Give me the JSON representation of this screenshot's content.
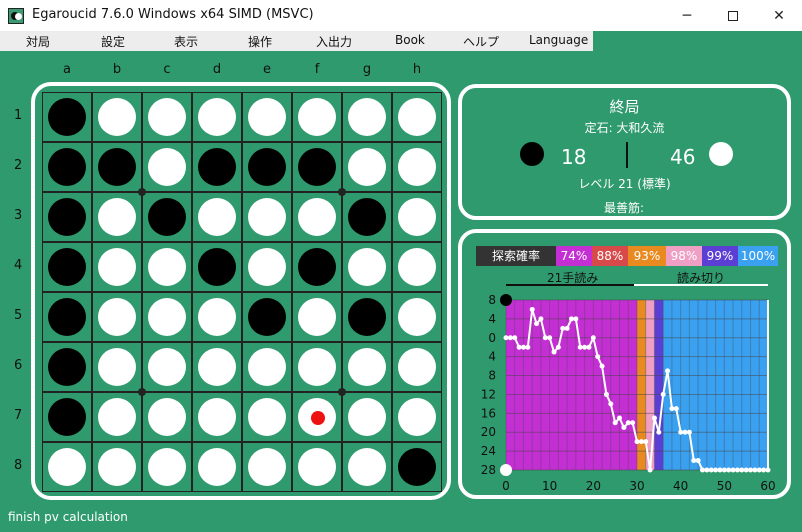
{
  "window": {
    "title": "Egaroucid 7.6.0 Windows x64 SIMD (MSVC)",
    "minimize": "─",
    "close": "✕"
  },
  "menu": [
    "対局",
    "設定",
    "表示",
    "操作",
    "入出力",
    "Book",
    "ヘルプ",
    "Language"
  ],
  "board": {
    "columns": [
      "a",
      "b",
      "c",
      "d",
      "e",
      "f",
      "g",
      "h"
    ],
    "rows": [
      "1",
      "2",
      "3",
      "4",
      "5",
      "6",
      "7",
      "8"
    ],
    "cells": [
      "BWWWWWWW",
      "BBWBBBWW",
      "BWBWWWBW",
      "BWWBWBWW",
      "BWWWBWBW",
      "BWWWWWWW",
      "BWWWWWWW",
      "WWWWWWWB"
    ],
    "hint": {
      "row": 6,
      "col": 5
    },
    "colors": {
      "black": "#000000",
      "white": "#ffffff",
      "hint": "#ee1111"
    }
  },
  "info": {
    "phase": "終局",
    "opening": "定石: 大和久流",
    "black_score": "18",
    "white_score": "46",
    "level": "レベル 21 (標準)",
    "best_line": "最善筋:"
  },
  "graph_legend": {
    "title": "探索確率",
    "items": [
      {
        "label": "74%",
        "color": "#c42fd4"
      },
      {
        "label": "88%",
        "color": "#d84a4a"
      },
      {
        "label": "93%",
        "color": "#e88a20"
      },
      {
        "label": "98%",
        "color": "#ef9fc4"
      },
      {
        "label": "99%",
        "color": "#5b3fd4"
      },
      {
        "label": "100%",
        "color": "#3aa0f0"
      }
    ],
    "depth_labels": [
      "21手読み",
      "読み切り"
    ]
  },
  "chart_data": {
    "type": "line",
    "x": [
      0,
      1,
      2,
      3,
      4,
      5,
      6,
      7,
      8,
      9,
      10,
      11,
      12,
      13,
      14,
      15,
      16,
      17,
      18,
      19,
      20,
      21,
      22,
      23,
      24,
      25,
      26,
      27,
      28,
      29,
      30,
      31,
      32,
      33,
      34,
      35,
      36,
      37,
      38,
      39,
      40,
      41,
      42,
      43,
      44,
      45,
      46,
      47,
      48,
      49,
      50,
      51,
      52,
      53,
      54,
      55,
      56,
      57,
      58,
      59,
      60
    ],
    "y": [
      0,
      0,
      0,
      -2,
      -2,
      -2,
      6,
      3,
      4,
      0,
      0,
      -3,
      -2,
      2,
      2,
      4,
      4,
      -2,
      -2,
      -2,
      0,
      -4,
      -6,
      -12,
      -14,
      -18,
      -17,
      -19,
      -18,
      -18,
      -22,
      -22,
      -22,
      -28,
      -17,
      -20,
      -12,
      -7,
      -15,
      -15,
      -20,
      -20,
      -20,
      -26,
      -26,
      -28,
      -28,
      -28,
      -28,
      -28,
      -28,
      -28,
      -28,
      -28,
      -28,
      -28,
      -28,
      -28,
      -28,
      -28,
      -28
    ],
    "xlim": [
      0,
      60
    ],
    "ylim": [
      -28,
      8
    ],
    "x_ticks": [
      0,
      10,
      20,
      30,
      40,
      50,
      60
    ],
    "y_tick_labels": [
      "8",
      "4",
      "0",
      "4",
      "8",
      "12",
      "16",
      "20",
      "24",
      "28"
    ],
    "bands": [
      {
        "from": 0,
        "to": 30,
        "color": "#c42fd4"
      },
      {
        "from": 30,
        "to": 32,
        "color": "#e88a20"
      },
      {
        "from": 32,
        "to": 34,
        "color": "#ef9fc4"
      },
      {
        "from": 34,
        "to": 36,
        "color": "#5b3fd4"
      },
      {
        "from": 36,
        "to": 60,
        "color": "#3aa0f0"
      }
    ],
    "grid": true
  },
  "status": "finish pv calculation"
}
